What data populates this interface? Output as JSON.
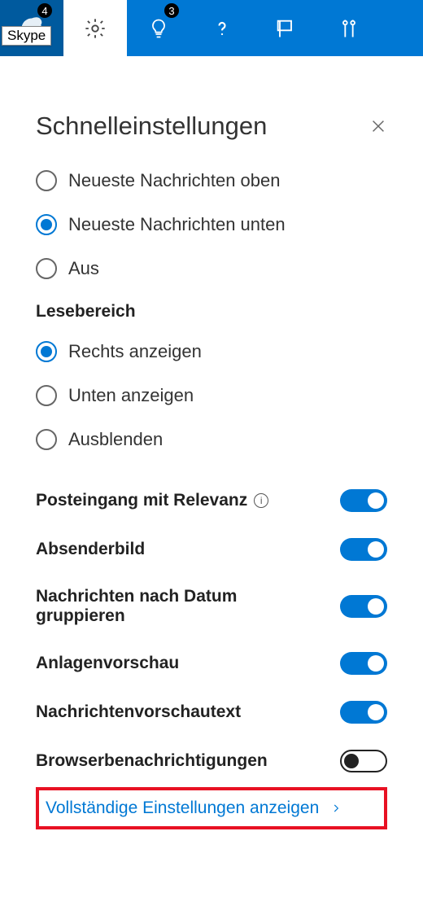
{
  "topbar": {
    "skype_tooltip": "Skype",
    "skype_badge": "4",
    "tips_badge": "3"
  },
  "panel": {
    "title": "Schnelleinstellungen"
  },
  "sort": {
    "opt1": "Neueste Nachrichten oben",
    "opt2": "Neueste Nachrichten unten",
    "opt3": "Aus"
  },
  "reading": {
    "header": "Lesebereich",
    "opt1": "Rechts anzeigen",
    "opt2": "Unten anzeigen",
    "opt3": "Ausblenden"
  },
  "toggles": {
    "focused": "Posteingang mit Relevanz",
    "sender_pic": "Absenderbild",
    "group_date": "Nachrichten nach Datum gruppieren",
    "attach_preview": "Anlagenvorschau",
    "msg_preview": "Nachrichtenvorschautext",
    "browser_notif": "Browserbenachrichtigungen"
  },
  "footer": {
    "full_settings": "Vollständige Einstellungen anzeigen"
  }
}
